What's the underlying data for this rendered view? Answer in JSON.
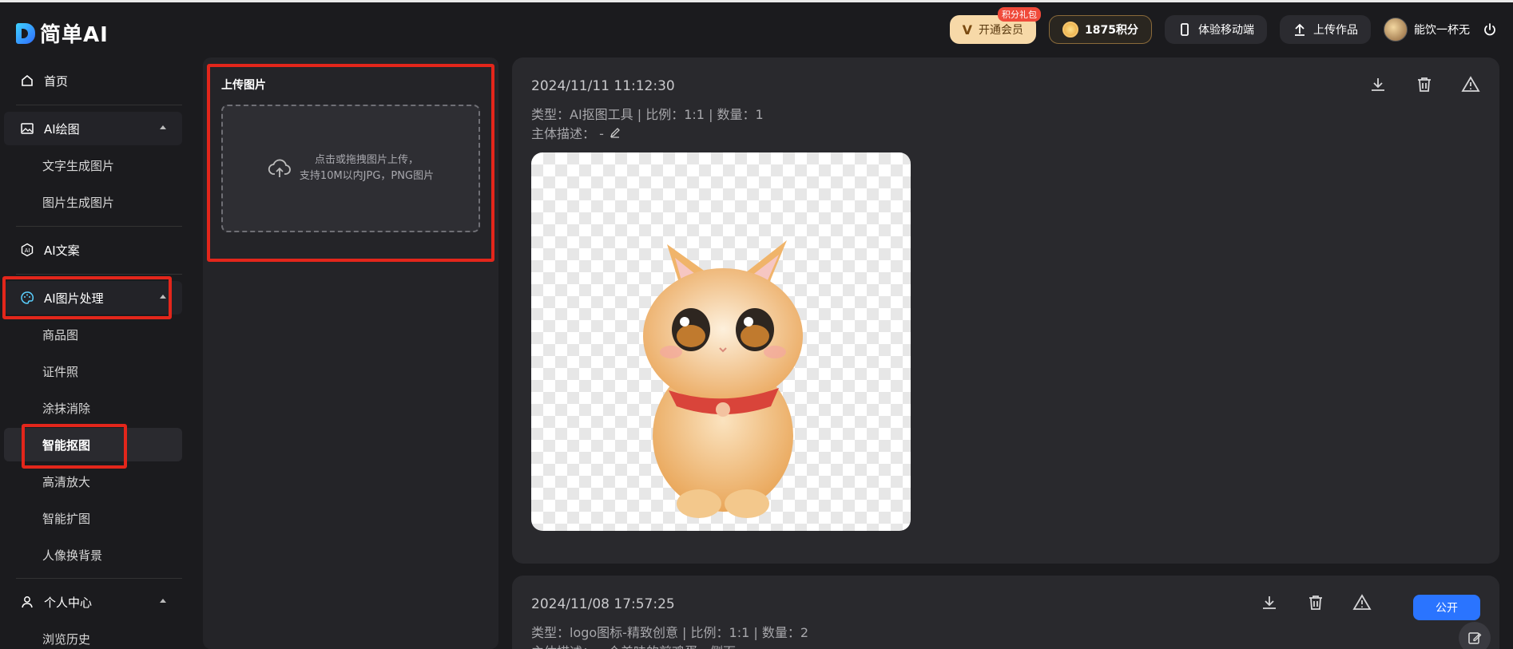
{
  "app": {
    "logo_text": "简单AI"
  },
  "topbar": {
    "vip_label": "开通会员",
    "vip_badge": "积分礼包",
    "points_label": "1875积分",
    "mobile_label": "体验移动端",
    "upload_label": "上传作品",
    "username": "能饮一杯无"
  },
  "sidebar": {
    "home": "首页",
    "ai_draw": "AI绘图",
    "text_to_image": "文字生成图片",
    "image_to_image": "图片生成图片",
    "ai_copy": "AI文案",
    "ai_image_process": "AI图片处理",
    "product_image": "商品图",
    "id_photo": "证件照",
    "erase": "涂抹消除",
    "smart_cutout": "智能抠图",
    "hd_upscale": "高清放大",
    "smart_expand": "智能扩图",
    "portrait_bg": "人像换背景",
    "personal_center": "个人中心",
    "history": "浏览历史"
  },
  "upload": {
    "title": "上传图片",
    "hint_line1": "点击或拖拽图片上传，",
    "hint_line2": "支持10M以内JPG，PNG图片"
  },
  "records": [
    {
      "timestamp": "2024/11/11 11:12:30",
      "meta": "类型：AI抠图工具 | 比例：1:1 | 数量：1",
      "subject": "主体描述：  -"
    },
    {
      "timestamp": "2024/11/08 17:57:25",
      "meta": "类型：logo图标-精致创意 | 比例：1:1 | 数量：2",
      "subject": "主体描述：一个美味的煎鸡蛋，侧面",
      "public_label": "公开"
    }
  ]
}
